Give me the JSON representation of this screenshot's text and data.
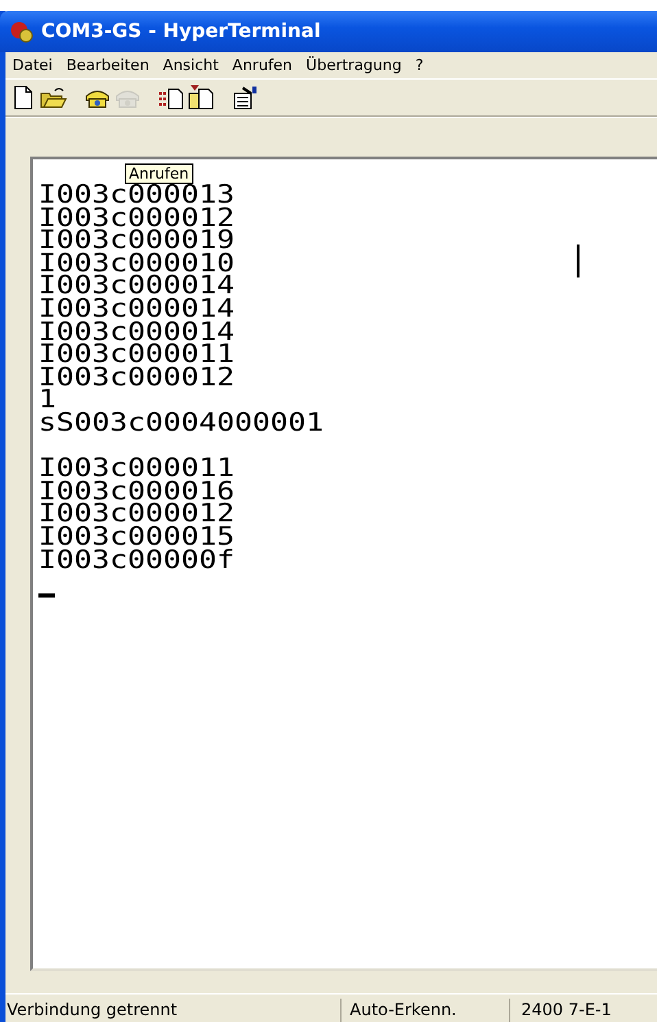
{
  "window": {
    "title": "COM3-GS - HyperTerminal"
  },
  "menu": [
    "Datei",
    "Bearbeiten",
    "Ansicht",
    "Anrufen",
    "Übertragung",
    "?"
  ],
  "toolbar": [
    {
      "kind": "new",
      "disabled": false
    },
    {
      "kind": "open",
      "disabled": false
    },
    {
      "kind": "call",
      "disabled": false
    },
    {
      "kind": "hangup",
      "disabled": true
    },
    {
      "kind": "send",
      "disabled": false
    },
    {
      "kind": "receive",
      "disabled": false
    },
    {
      "kind": "properties",
      "disabled": false
    }
  ],
  "tooltip": {
    "text": "Anrufen"
  },
  "terminal": {
    "blocks": [
      {
        "lines": [
          "I003c000013",
          "I003c000012",
          "I003c000019",
          "I003c000010",
          "I003c000014",
          "I003c000014",
          "I003c000014",
          "I003c000011",
          "I003c000012",
          "1",
          "sS003c0004000001"
        ]
      },
      {
        "lines": [
          "I003c000011",
          "I003c000016",
          "I003c000012",
          "I003c000015",
          "I003c00000f"
        ]
      }
    ]
  },
  "status_bar": [
    "Verbindung getrennt",
    "Auto-Erkenn.",
    "2400 7-E-1"
  ]
}
